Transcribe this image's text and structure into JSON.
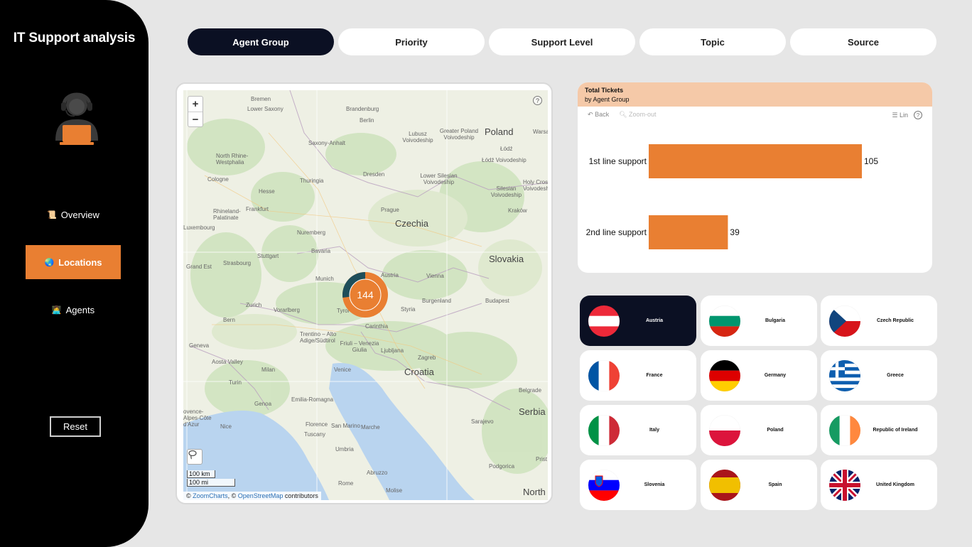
{
  "app": {
    "title": "IT Support analysis"
  },
  "nav": [
    {
      "label": "Overview",
      "icon": "📜",
      "icon_name": "scroll-icon",
      "active": false
    },
    {
      "label": "Locations",
      "icon": "🌏",
      "icon_name": "globe-icon",
      "active": true
    },
    {
      "label": "Agents",
      "icon": "👩‍💻",
      "icon_name": "agent-icon",
      "active": false
    }
  ],
  "reset_label": "Reset",
  "tabs": [
    {
      "label": "Agent Group",
      "active": true
    },
    {
      "label": "Priority",
      "active": false
    },
    {
      "label": "Support Level",
      "active": false
    },
    {
      "label": "Topic",
      "active": false
    },
    {
      "label": "Source",
      "active": false
    }
  ],
  "map": {
    "zoom_in": "+",
    "zoom_out": "−",
    "help": "?",
    "scale_km": "100 km",
    "scale_mi": "100 mi",
    "attribution_prefix": "© ",
    "attribution_zoomcharts": "ZoomCharts",
    "attribution_sep": ", © ",
    "attribution_osm": "OpenStreetMap",
    "attribution_suffix": " contributors",
    "cluster_value": "144",
    "cluster_fraction_teal": 0.27,
    "labels": {
      "poland": "Poland",
      "czechia": "Czechia",
      "slovakia": "Slovakia",
      "croatia": "Croatia",
      "serbia": "Serbia",
      "north": "North",
      "bremen": "Bremen",
      "lower_saxony": "Lower Saxony",
      "brandenburg": "Brandenburg",
      "berlin": "Berlin",
      "saxony_anhalt": "Saxony-Anhalt",
      "lubusz": "Lubusz Voivodeship",
      "greater_poland": "Greater Poland Voivodeship",
      "warsaw": "Warsa",
      "lodz": "Łódź",
      "lodz_v": "Łódź Voivodeship",
      "nrw": "North Rhine-Westphalia",
      "cologne": "Cologne",
      "hesse": "Hesse",
      "thuringia": "Thuringia",
      "dresden": "Dresden",
      "lower_silesian": "Lower Silesian Voivodeship",
      "silesian": "Silesian Voivodeship",
      "holy_cross": "Holy Cros Voivodesh",
      "frankfurt": "Frankfurt",
      "rhineland": "Rhineland-Palatinate",
      "prague": "Prague",
      "krakow": "Kraków",
      "luxembourg": "Luxembourg",
      "nuremberg": "Nuremberg",
      "bavaria": "Bavaria",
      "stuttgart": "Stuttgart",
      "strasbourg": "Strasbourg",
      "grand_est": "Grand Est",
      "munich": "Munich",
      "austria": "Austria",
      "vienna": "Vienna",
      "burgenland": "Burgenland",
      "budapest": "Budapest",
      "zurich": "Zurich",
      "vorarlberg": "Vorarlberg",
      "tyrol": "Tyrol",
      "styria": "Styria",
      "bern": "Bern",
      "carinthia": "Carinthia",
      "trentino": "Trentino – Alto Adige/Südtirol",
      "friuli": "Friuli – Venezia Giulia",
      "ljubljana": "Ljubljana",
      "geneva": "Geneva",
      "aosta": "Aosta Valley",
      "milan": "Milan",
      "venice": "Venice",
      "zagreb": "Zagreb",
      "turin": "Turin",
      "emilia": "Emilia-Romagna",
      "genoa": "Genoa",
      "belgrade": "Belgrade",
      "provence": "ovence-Alpes-Côte d'Azur",
      "nice": "Nice",
      "florence": "Florence",
      "tuscany": "Tuscany",
      "marche": "Marche",
      "san_marino": "San Marino",
      "umbria": "Umbria",
      "sarajevo": "Sarajevo",
      "rome": "Rome",
      "abruzzo": "Abruzzo",
      "molise": "Molise",
      "podgorica": "Podgorica",
      "pristina": "Prist"
    }
  },
  "chart": {
    "title": "Total Tickets",
    "subtitle": "by Agent Group",
    "toolbar": {
      "back": "Back",
      "zoom_out": "Zoom-out",
      "scale": "Lin",
      "help": "?"
    },
    "bar_color": "#e97f32"
  },
  "chart_data": {
    "type": "bar",
    "orientation": "horizontal",
    "title": "Total Tickets",
    "subtitle": "by Agent Group",
    "categories": [
      "1st line support",
      "2nd line support"
    ],
    "values": [
      105,
      39
    ],
    "xlim": [
      0,
      130
    ]
  },
  "countries": [
    {
      "name": "Austria",
      "flag": "austria",
      "active": true
    },
    {
      "name": "Bulgaria",
      "flag": "bulgaria",
      "active": false
    },
    {
      "name": "Czech Republic",
      "flag": "czech",
      "active": false
    },
    {
      "name": "France",
      "flag": "france",
      "active": false
    },
    {
      "name": "Germany",
      "flag": "germany",
      "active": false
    },
    {
      "name": "Greece",
      "flag": "greece",
      "active": false
    },
    {
      "name": "Italy",
      "flag": "italy",
      "active": false
    },
    {
      "name": "Poland",
      "flag": "poland",
      "active": false
    },
    {
      "name": "Republic of Ireland",
      "flag": "ireland",
      "active": false
    },
    {
      "name": "Slovenia",
      "flag": "slovenia",
      "active": false
    },
    {
      "name": "Spain",
      "flag": "spain",
      "active": false
    },
    {
      "name": "United Kingdom",
      "flag": "uk",
      "active": false
    }
  ]
}
